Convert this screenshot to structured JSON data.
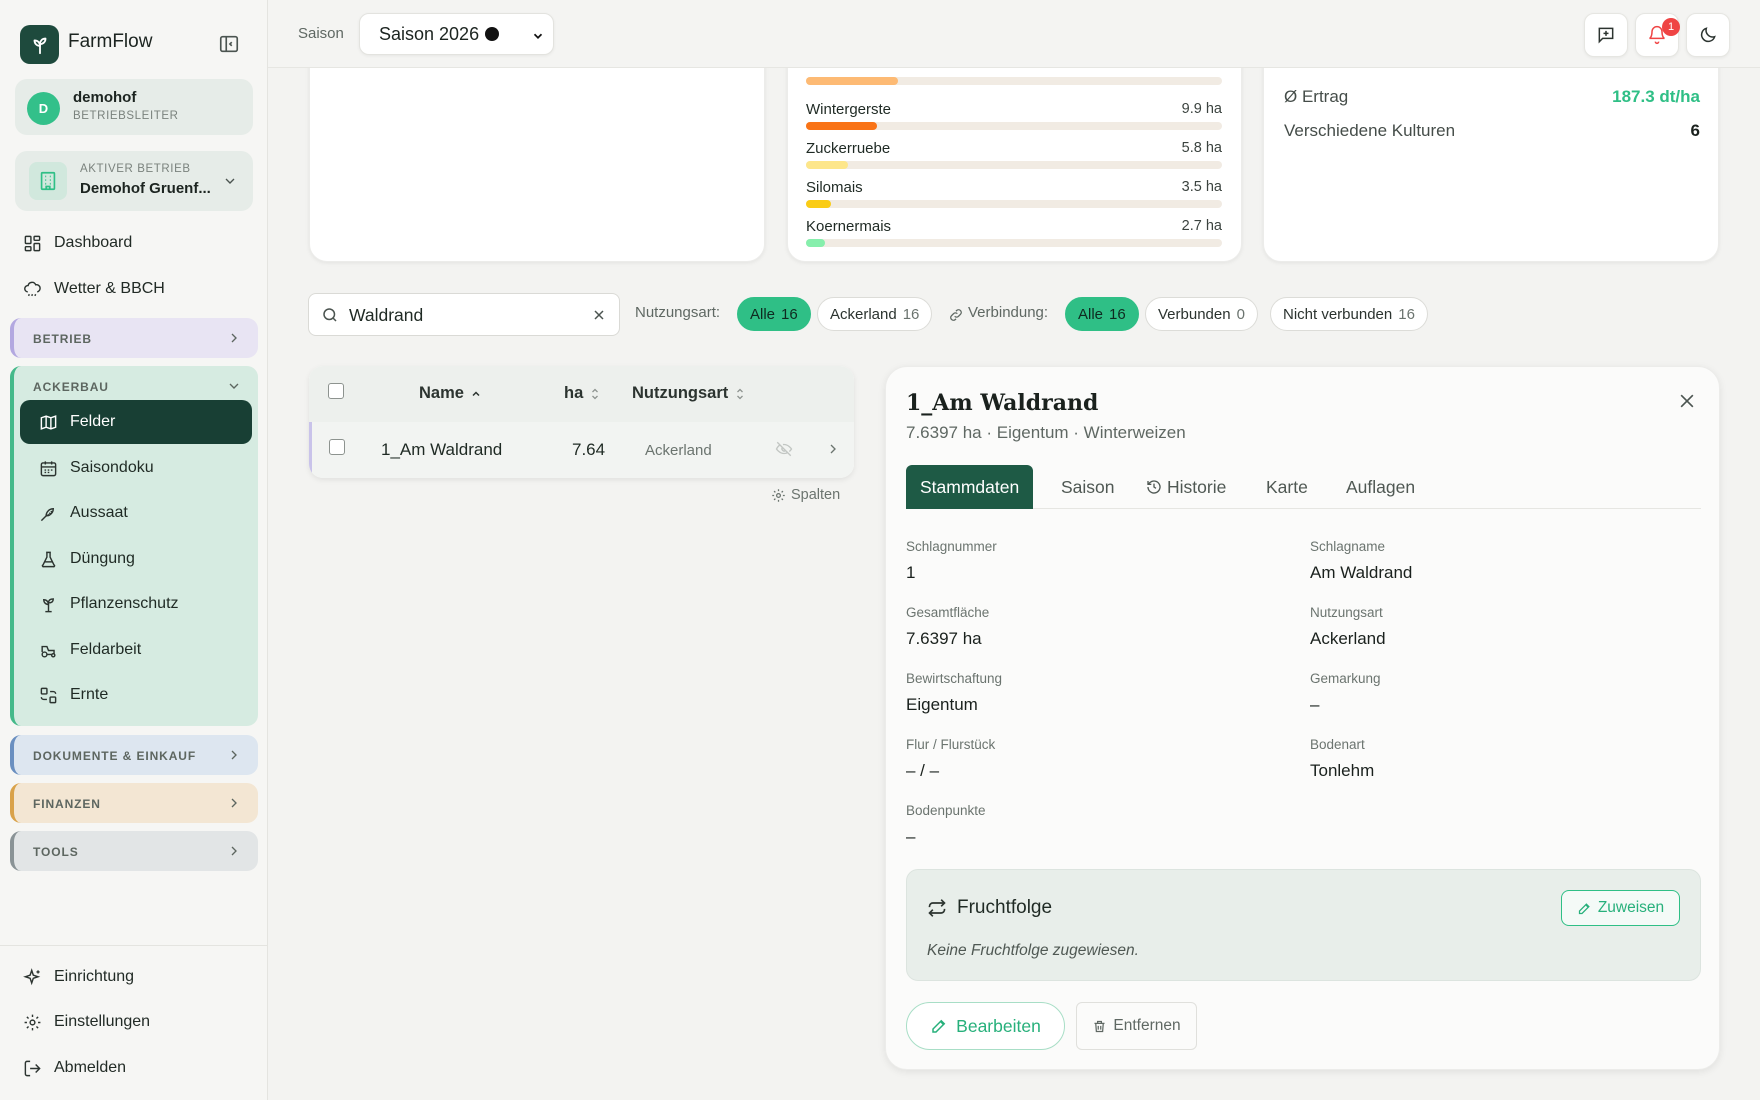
{
  "app": {
    "title": "FarmFlow"
  },
  "user": {
    "initial": "D",
    "name": "demohof",
    "role": "BETRIEBSLEITER"
  },
  "farm": {
    "label": "AKTIVER BETRIEB",
    "name": "Demohof Gruenf..."
  },
  "nav": {
    "dashboard": "Dashboard",
    "weather": "Wetter & BBCH"
  },
  "sections": {
    "betrieb": "BETRIEB",
    "ackerbau": "ACKERBAU",
    "dokumente": "DOKUMENTE & EINKAUF",
    "finanzen": "FINANZEN",
    "tools": "TOOLS"
  },
  "ackerbau_items": [
    {
      "label": "Felder",
      "icon": "map-icon"
    },
    {
      "label": "Saisondoku",
      "icon": "calendar-icon"
    },
    {
      "label": "Aussaat",
      "icon": "seed-icon"
    },
    {
      "label": "Düngung",
      "icon": "flask-icon"
    },
    {
      "label": "Pflanzenschutz",
      "icon": "sprout-icon"
    },
    {
      "label": "Feldarbeit",
      "icon": "tractor-icon"
    },
    {
      "label": "Ernte",
      "icon": "harvest-icon"
    }
  ],
  "footer_nav": {
    "setup": "Einrichtung",
    "settings": "Einstellungen",
    "logout": "Abmelden"
  },
  "topbar": {
    "season_label": "Saison",
    "season_value": "Saison 2026",
    "notification_count": "1"
  },
  "crops": [
    {
      "name": "Wintergerste",
      "value": "9.9 ha",
      "fraction": 0.17,
      "color": "#f97316"
    },
    {
      "name": "Zuckerruebe",
      "value": "5.8 ha",
      "fraction": 0.1,
      "color": "#fde68a"
    },
    {
      "name": "Silomais",
      "value": "3.5 ha",
      "fraction": 0.06,
      "color": "#facc15"
    },
    {
      "name": "Koernermais",
      "value": "2.7 ha",
      "fraction": 0.045,
      "color": "#86efac"
    }
  ],
  "partial_crop_bar": {
    "fraction": 0.22,
    "color": "#fdba74"
  },
  "stats": {
    "yield_label": "Ø Ertrag",
    "yield_value": "187.3 dt/ha",
    "cultures_label": "Verschiedene Kulturen",
    "cultures_value": "6"
  },
  "filters": {
    "search_value": "Waldrand",
    "usage_label": "Nutzungsart:",
    "usage_all": "Alle",
    "usage_all_count": "16",
    "usage_arable": "Ackerland",
    "usage_arable_count": "16",
    "conn_label": "Verbindung:",
    "conn_all": "Alle",
    "conn_all_count": "16",
    "conn_connected": "Verbunden",
    "conn_connected_count": "0",
    "conn_not": "Nicht verbunden",
    "conn_not_count": "16"
  },
  "table": {
    "headers": {
      "name": "Name",
      "ha": "ha",
      "usage": "Nutzungsart"
    },
    "rows": [
      {
        "name": "1_Am Waldrand",
        "ha": "7.64",
        "usage": "Ackerland"
      }
    ],
    "columns_button": "Spalten"
  },
  "detail": {
    "title": "1_Am Waldrand",
    "subtitle": "7.6397 ha · Eigentum · Winterweizen",
    "tabs": [
      "Stammdaten",
      "Saison",
      "Historie",
      "Karte",
      "Auflagen"
    ],
    "fields": {
      "schlagnummer_label": "Schlagnummer",
      "schlagnummer": "1",
      "schlagname_label": "Schlagname",
      "schlagname": "Am Waldrand",
      "gesamtflaeche_label": "Gesamtfläche",
      "gesamtflaeche": "7.6397 ha",
      "nutzungsart_label": "Nutzungsart",
      "nutzungsart": "Ackerland",
      "bewirtschaftung_label": "Bewirtschaftung",
      "bewirtschaftung": "Eigentum",
      "gemarkung_label": "Gemarkung",
      "gemarkung": "–",
      "flur_label": "Flur / Flurstück",
      "flur": "– / –",
      "bodenart_label": "Bodenart",
      "bodenart": "Tonlehm",
      "bodenpunkte_label": "Bodenpunkte",
      "bodenpunkte": "–"
    },
    "rotation": {
      "title": "Fruchtfolge",
      "assign": "Zuweisen",
      "empty": "Keine Fruchtfolge zugewiesen."
    },
    "edit": "Bearbeiten",
    "remove": "Entfernen"
  },
  "colors": {
    "accent": "#2fbf86",
    "dark_green": "#183f34"
  }
}
